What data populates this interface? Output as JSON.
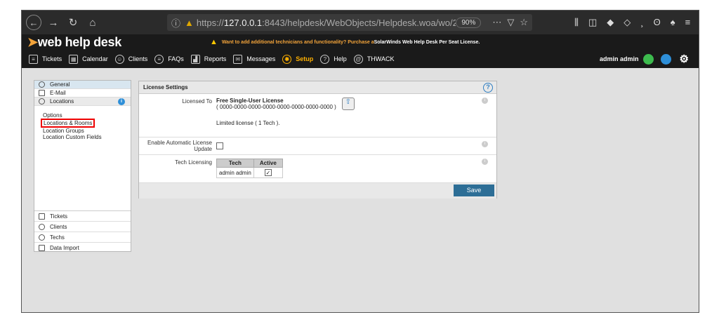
{
  "browser": {
    "url_prefix": "https://",
    "url_host": "127.0.0.1",
    "url_rest": ":8443/helpdesk/WebObjects/Helpdesk.woa/wo/2.7.1",
    "zoom": "90%"
  },
  "app": {
    "logo": "web help desk",
    "promo_text": "Want to add additional technicians and functionality? Purchase a ",
    "promo_link": "SolarWinds Web Help Desk Per Seat License."
  },
  "nav": {
    "items": [
      "Tickets",
      "Calendar",
      "Clients",
      "FAQs",
      "Reports",
      "Messages",
      "Setup",
      "Help",
      "THWACK"
    ],
    "active": "Setup",
    "user": "admin admin"
  },
  "sidebar": {
    "general": "General",
    "email": "E-Mail",
    "locations": "Locations",
    "sub_items": [
      "Options",
      "Locations & Rooms",
      "Location Groups",
      "Location Custom Fields"
    ],
    "bottom": [
      "Tickets",
      "Clients",
      "Techs",
      "Data Import"
    ]
  },
  "panel": {
    "title": "License Settings",
    "licensed_to_label": "Licensed To",
    "license_name": "Free Single-User License",
    "license_key": "( 0000-0000-0000-0000-0000-0000-0000-0000 )",
    "limited": "Limited license ( 1 Tech ).",
    "auto_update_label": "Enable Automatic License Update",
    "tech_licensing_label": "Tech Licensing",
    "table_headers": [
      "Tech",
      "Active"
    ],
    "table_rows": [
      {
        "tech": "admin admin",
        "active": "✓"
      }
    ],
    "save": "Save"
  }
}
